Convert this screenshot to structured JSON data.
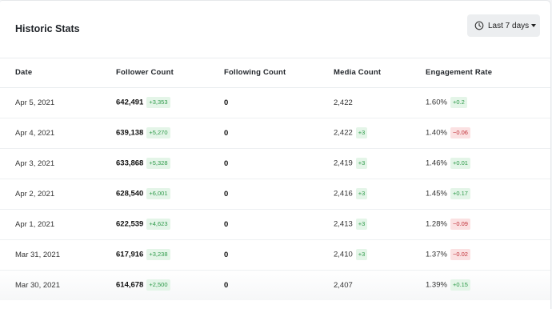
{
  "header": {
    "title": "Historic Stats",
    "range_label": "Last 7 days"
  },
  "colors": {
    "positive_bg": "#e4f5e8",
    "positive_text": "#2e9a4a",
    "negative_bg": "#fbe1e2",
    "negative_text": "#c0323a"
  },
  "icons": {
    "range": "clock-icon",
    "dropdown": "caret-down-icon"
  },
  "table": {
    "columns": [
      "Date",
      "Follower  Count",
      "Following  Count",
      "Media  Count",
      "Engagement  Rate"
    ],
    "rows": [
      {
        "date": "Apr  5,  2021",
        "followers": "642,491",
        "followers_delta": "+3,353",
        "following": "0",
        "media": "2,422",
        "media_delta": "",
        "engagement": "1.60%",
        "engagement_delta": "+0.2"
      },
      {
        "date": "Apr  4,  2021",
        "followers": "639,138",
        "followers_delta": "+5,270",
        "following": "0",
        "media": "2,422",
        "media_delta": "+3",
        "engagement": "1.40%",
        "engagement_delta": "−0.06"
      },
      {
        "date": "Apr  3,  2021",
        "followers": "633,868",
        "followers_delta": "+5,328",
        "following": "0",
        "media": "2,419",
        "media_delta": "+3",
        "engagement": "1.46%",
        "engagement_delta": "+0.01"
      },
      {
        "date": "Apr  2,  2021",
        "followers": "628,540",
        "followers_delta": "+6,001",
        "following": "0",
        "media": "2,416",
        "media_delta": "+3",
        "engagement": "1.45%",
        "engagement_delta": "+0.17"
      },
      {
        "date": "Apr  1,  2021",
        "followers": "622,539",
        "followers_delta": "+4,623",
        "following": "0",
        "media": "2,413",
        "media_delta": "+3",
        "engagement": "1.28%",
        "engagement_delta": "−0.09"
      },
      {
        "date": "Mar  31,  2021",
        "followers": "617,916",
        "followers_delta": "+3,238",
        "following": "0",
        "media": "2,410",
        "media_delta": "+3",
        "engagement": "1.37%",
        "engagement_delta": "−0.02"
      },
      {
        "date": "Mar  30,  2021",
        "followers": "614,678",
        "followers_delta": "+2,500",
        "following": "0",
        "media": "2,407",
        "media_delta": "",
        "engagement": "1.39%",
        "engagement_delta": "+0.15"
      }
    ]
  }
}
